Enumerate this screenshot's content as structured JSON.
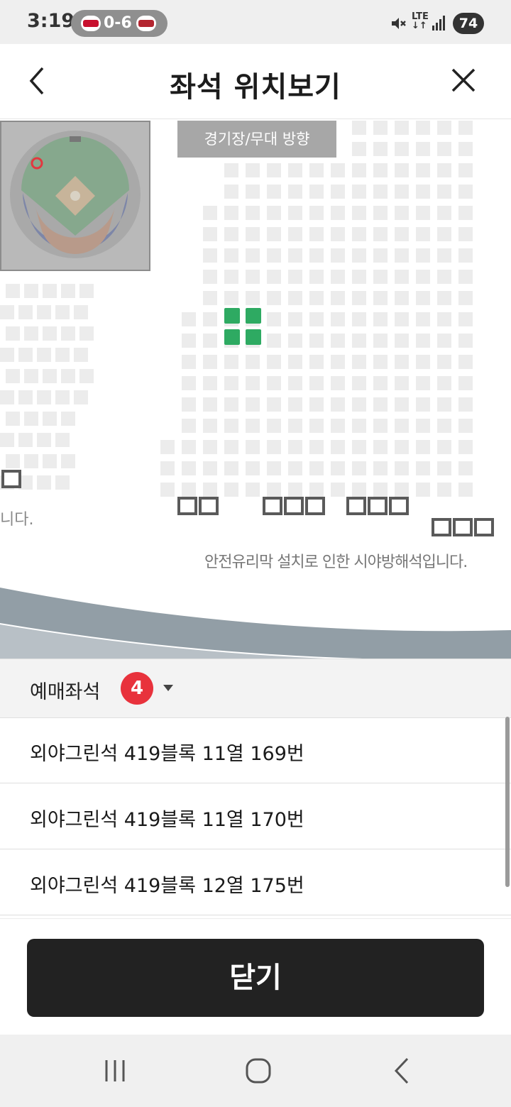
{
  "status_bar": {
    "time": "3:19",
    "score": "0-6",
    "network": "LTE",
    "battery": "74",
    "icons": [
      "mute-icon",
      "signal-icon"
    ]
  },
  "header": {
    "title": "좌석 위치보기",
    "back_icon": "back-chevron-icon",
    "close_icon": "close-x-icon"
  },
  "seat_map": {
    "stage_direction_label": "경기장/무대 방향",
    "glass_note": "안전유리막 설치로 인한 시야방해석입니다.",
    "glass_note_left_fragment": "니다.",
    "highlight_color": "#2eaa62"
  },
  "selection": {
    "label": "예매좌석",
    "count": "4",
    "badge_color": "#e8323c",
    "seats": [
      "외야그린석 419블록 11열 169번",
      "외야그린석 419블록 11열 170번",
      "외야그린석 419블록 12열 175번"
    ]
  },
  "footer": {
    "close_button_label": "닫기"
  },
  "nav_bar": {
    "icons": [
      "recent-apps-icon",
      "home-icon",
      "back-icon"
    ]
  }
}
